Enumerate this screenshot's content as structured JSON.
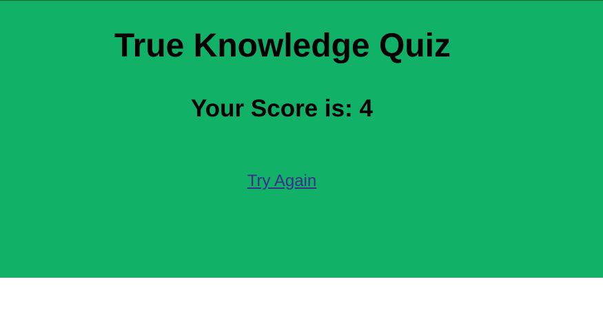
{
  "quiz": {
    "title": "True Knowledge Quiz",
    "score_label": "Your Score is: ",
    "score_value": "4",
    "retry_label": "Try Again"
  },
  "colors": {
    "panel_background": "#12b168",
    "page_background": "#ffffff",
    "link": "#3b2f8a",
    "text": "#000000"
  }
}
